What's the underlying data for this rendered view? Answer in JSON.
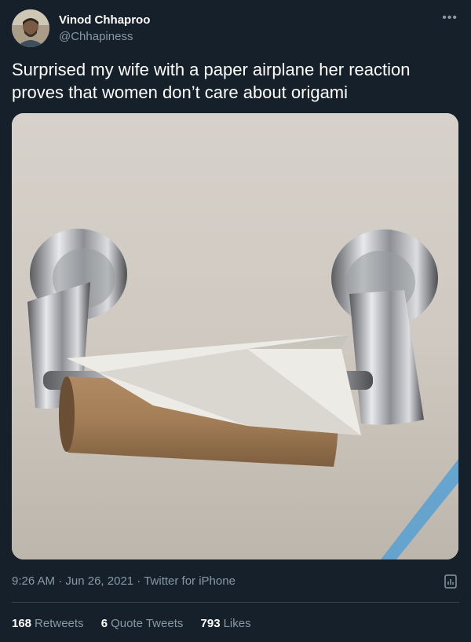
{
  "user": {
    "name": "Vinod Chhaproo",
    "handle": "@Chhapiness"
  },
  "tweet": {
    "text_line1": "Surprised my wife with a paper airplane her reaction",
    "text_line2": "proves that women don’t care about origami"
  },
  "meta": {
    "time": "9:26 AM",
    "date": "Jun 26, 2021",
    "source": "Twitter for iPhone",
    "separator": " · "
  },
  "stats": {
    "retweets_count": "168",
    "retweets_label": "Retweets",
    "quote_count": "6",
    "quote_label": "Quote Tweets",
    "likes_count": "793",
    "likes_label": "Likes"
  },
  "icons": {
    "more": "more-icon",
    "analytics": "analytics-icon"
  },
  "colors": {
    "background": "#15202b",
    "secondary_text": "#8899a6",
    "divider": "#38444d"
  }
}
